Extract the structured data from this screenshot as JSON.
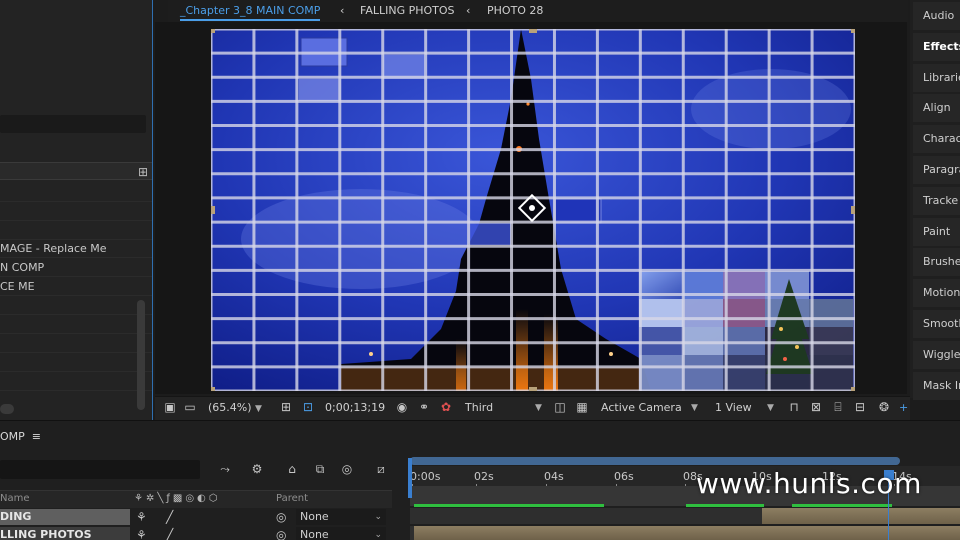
{
  "comp_tabs": {
    "main": "_Chapter 3_8 MAIN COMP",
    "arrow1": "‹",
    "second": "FALLING PHOTOS",
    "arrow2": "‹",
    "third": "PHOTO 28"
  },
  "project": {
    "items": [
      {
        "label": "MAGE - Replace Me"
      },
      {
        "label": "N COMP"
      },
      {
        "label": "CE ME"
      }
    ]
  },
  "viewer_toolbar": {
    "zoom": "(65.4%)",
    "timecode": "0;00;13;19",
    "resolution": "Third",
    "camera": "Active Camera",
    "views": "1 View",
    "plus": "+"
  },
  "right_panel": {
    "items": [
      {
        "label": "Audio",
        "active": false
      },
      {
        "label": "Effects",
        "active": true
      },
      {
        "label": "Librarie",
        "active": false
      },
      {
        "label": "Align",
        "active": false
      },
      {
        "label": "Charac",
        "active": false
      },
      {
        "label": "Paragra",
        "active": false
      },
      {
        "label": "Tracke",
        "active": false
      },
      {
        "label": "Paint",
        "active": false
      },
      {
        "label": "Brushe",
        "active": false
      },
      {
        "label": "Motion",
        "active": false
      },
      {
        "label": "Smooth",
        "active": false
      },
      {
        "label": "Wiggle",
        "active": false
      },
      {
        "label": "Mask In",
        "active": false
      }
    ]
  },
  "timeline": {
    "tab_label": "OMP",
    "menu": "≡",
    "col_name": "Name",
    "col_parent": "Parent",
    "layers": [
      {
        "name": "DING",
        "parent": "None"
      },
      {
        "name": "LLING PHOTOS",
        "parent": "None"
      }
    ],
    "ticks": [
      "0:00s",
      "02s",
      "04s",
      "06s",
      "08s",
      "10s",
      "12s",
      "14s"
    ]
  },
  "watermark": "www.hunls.com",
  "colors": {
    "accent": "#3a7fd0",
    "tab_active": "#4b9ee8",
    "sky": "#1c2f9a"
  }
}
